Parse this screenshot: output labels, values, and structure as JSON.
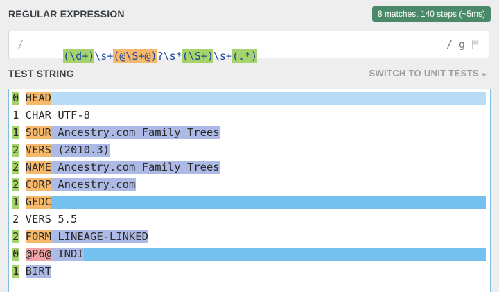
{
  "header": {
    "regex_label": "REGULAR EXPRESSION",
    "match_info": "8 matches, 140 steps (~5ms)"
  },
  "regex": {
    "delimiter": "/",
    "parts": [
      "(\\d+)",
      "\\s+",
      "(@\\S+@)",
      "?\\s*",
      "(\\S+)",
      "\\s+",
      "(.*)",
      ")"
    ],
    "flags": "/ g"
  },
  "test": {
    "label": "TEST STRING",
    "switch_label": "SWITCH TO UNIT TESTS",
    "lines": [
      {
        "level": "0",
        "tag": "HEAD",
        "value": "",
        "match": "full"
      },
      {
        "level": "1",
        "tag": "CHAR",
        "value": "UTF-8",
        "match": "none"
      },
      {
        "level": "1",
        "tag": "SOUR",
        "value": "Ancestry.com Family Trees",
        "match": "groups"
      },
      {
        "level": "2",
        "tag": "VERS",
        "value": "(2010.3)",
        "match": "groups"
      },
      {
        "level": "2",
        "tag": "NAME",
        "value": "Ancestry.com Family Trees",
        "match": "groups"
      },
      {
        "level": "2",
        "tag": "CORP",
        "value": "Ancestry.com",
        "match": "groups"
      },
      {
        "level": "1",
        "tag": "GEDC",
        "value": "",
        "match": "blue"
      },
      {
        "level": "2",
        "tag": "VERS",
        "value": "5.5",
        "match": "none"
      },
      {
        "level": "2",
        "tag": "FORM",
        "value": "LINEAGE-LINKED",
        "match": "groups"
      },
      {
        "level": "0",
        "tag": "@P6@",
        "value": "INDI",
        "match": "xref"
      },
      {
        "level": "1",
        "tag": "BIRT",
        "value": "",
        "match": "value"
      }
    ]
  },
  "colors": {
    "level": "#a6d36b",
    "tag": "#f6b86b",
    "xref": "#f1a3a8",
    "value": "#adbae6",
    "full_line": "#b8dcf5",
    "blue_line": "#74c0ee",
    "badge": "#4a8a6a"
  },
  "icons": {
    "flag": "flag-icon",
    "chevron": "chevron-right-icon"
  }
}
